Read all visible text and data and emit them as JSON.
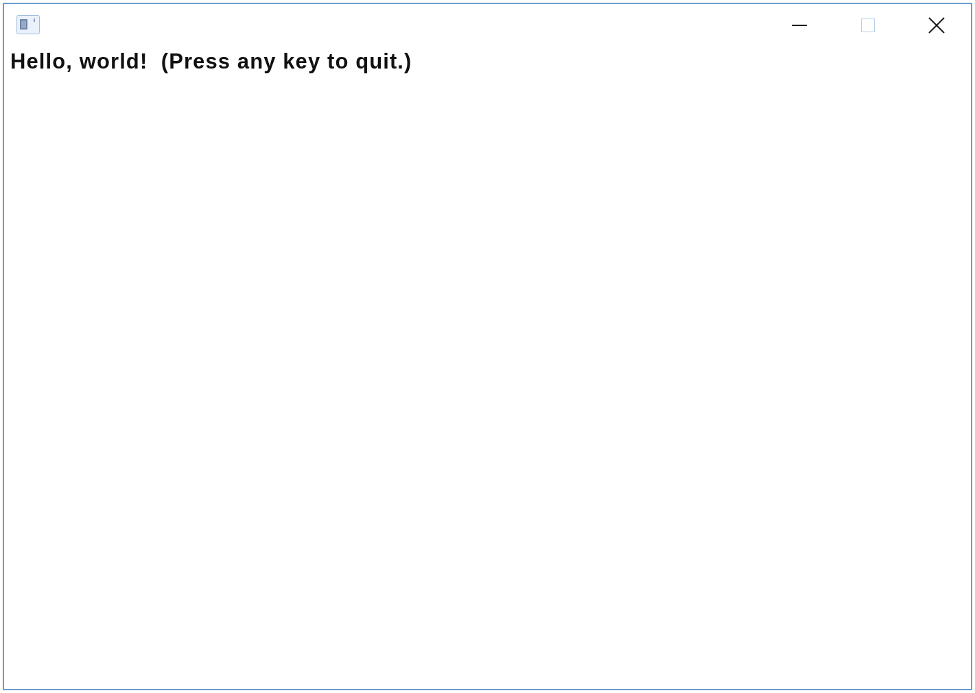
{
  "window": {
    "controls": [
      {
        "kind": "minimize",
        "disabled": false
      },
      {
        "kind": "maximize",
        "disabled": true
      },
      {
        "kind": "close",
        "disabled": false
      }
    ]
  },
  "content": {
    "message": "Hello, world!  (Press any key to quit.)"
  }
}
